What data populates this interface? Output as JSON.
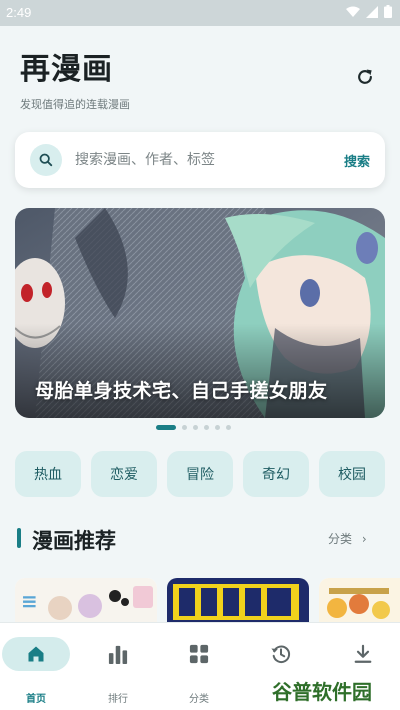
{
  "status_bar": {
    "time": "2:49"
  },
  "header": {
    "title": "再漫画",
    "subtitle": "发现值得追的连载漫画"
  },
  "search": {
    "placeholder": "搜索漫画、作者、标签",
    "submit_label": "搜索"
  },
  "banner": {
    "title": "母胎单身技术宅、自己手搓女朋友",
    "page_count": 6,
    "active_index": 0
  },
  "categories": [
    "热血",
    "恋爱",
    "冒险",
    "奇幻",
    "校园"
  ],
  "section": {
    "title": "漫画推荐",
    "more_label": "分类"
  },
  "bottom_nav": [
    {
      "label": "首页",
      "icon": "home-icon",
      "active": true
    },
    {
      "label": "排行",
      "icon": "bar-chart-icon",
      "active": false
    },
    {
      "label": "分类",
      "icon": "grid-icon",
      "active": false
    },
    {
      "label": "",
      "icon": "history-icon",
      "active": false
    },
    {
      "label": "",
      "icon": "download-icon",
      "active": false
    }
  ],
  "watermark": "谷普软件园",
  "colors": {
    "accent": "#1a7e86",
    "chip_bg": "#d9eeee",
    "background": "#f1f6f7"
  }
}
